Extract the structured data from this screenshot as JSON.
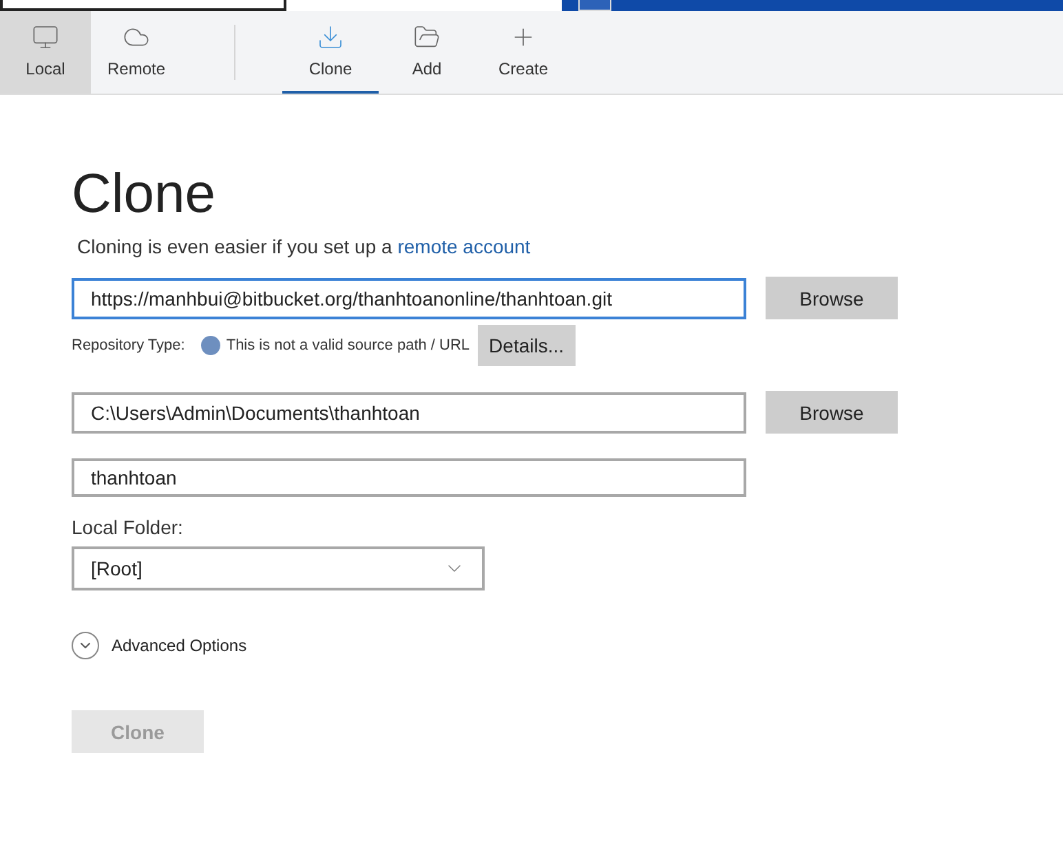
{
  "toolbar": {
    "modes": [
      {
        "label": "Local",
        "kind": "local",
        "selected": true
      },
      {
        "label": "Remote",
        "kind": "remote",
        "selected": false
      }
    ],
    "actions": [
      {
        "label": "Clone",
        "kind": "clone",
        "selected": true
      },
      {
        "label": "Add",
        "kind": "add",
        "selected": false
      },
      {
        "label": "Create",
        "kind": "create",
        "selected": false
      }
    ]
  },
  "form": {
    "title": "Clone",
    "subtitle": "Cloning is even easier if you set up a",
    "subtitle_link": "remote account",
    "source_url": {
      "value": "https://manhbui@bitbucket.org/thanhtoanonline/thanhtoan.git",
      "focused": true
    },
    "source_browse": "Browse",
    "repo_type_label": "Repository Type:",
    "repo_type_message": "This is not a valid source path / URL",
    "details_button": "Details...",
    "destination": {
      "value": "C:\\Users\\Admin\\Documents\\thanhtoan"
    },
    "destination_browse": "Browse",
    "name": {
      "value": "thanhtoan"
    },
    "local_folder_label": "Local Folder:",
    "local_folder": {
      "value": "[Root]"
    },
    "advanced_options": {
      "label": "Advanced Options",
      "expanded": false
    },
    "clone_button": {
      "label": "Clone",
      "disabled": true
    }
  }
}
